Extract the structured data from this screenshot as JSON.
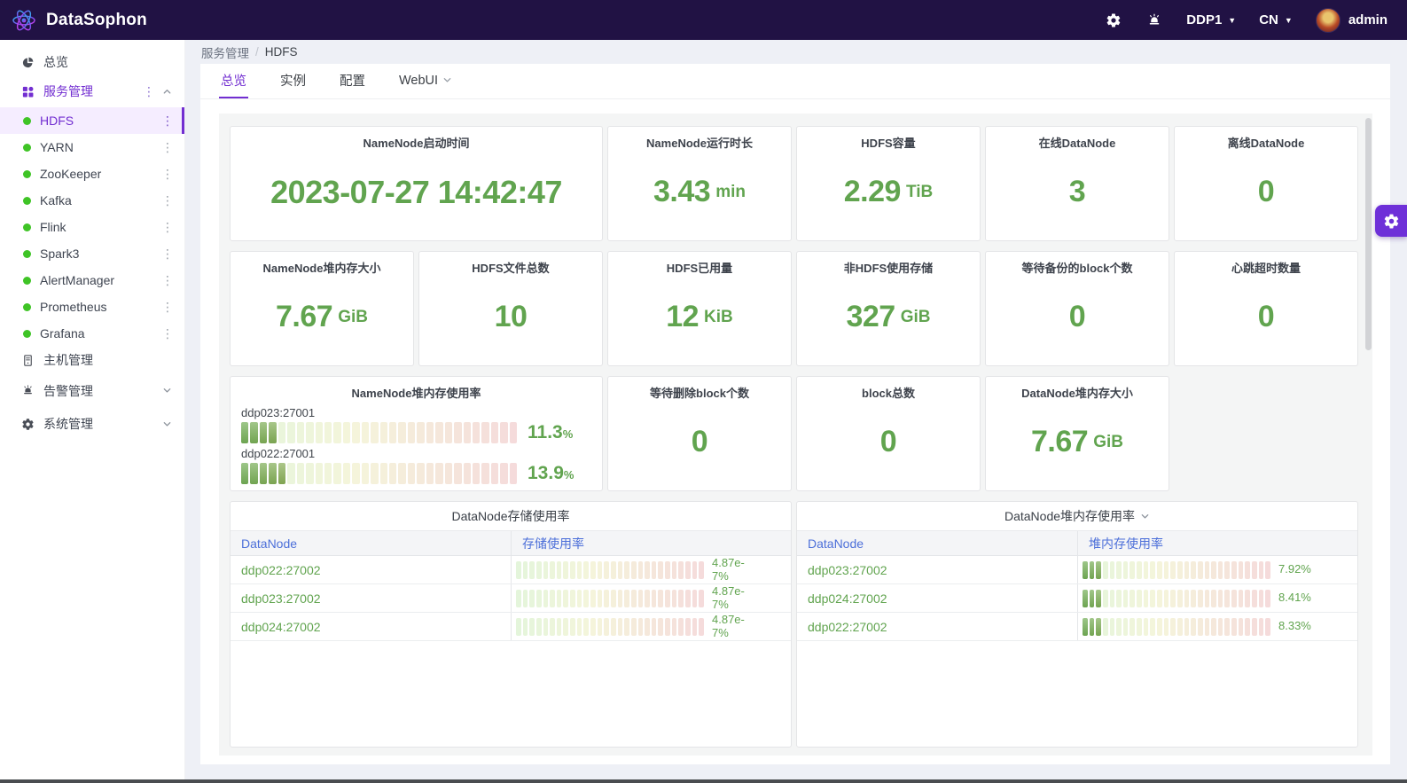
{
  "navbar": {
    "brand": "DataSophon",
    "cluster": "DDP1",
    "lang": "CN",
    "user": "admin"
  },
  "sidebar": {
    "overview": "总览",
    "service_mgmt": "服务管理",
    "services": [
      {
        "name": "HDFS",
        "active": true
      },
      {
        "name": "YARN",
        "active": false
      },
      {
        "name": "ZooKeeper",
        "active": false
      },
      {
        "name": "Kafka",
        "active": false
      },
      {
        "name": "Flink",
        "active": false
      },
      {
        "name": "Spark3",
        "active": false
      },
      {
        "name": "AlertManager",
        "active": false
      },
      {
        "name": "Prometheus",
        "active": false
      },
      {
        "name": "Grafana",
        "active": false
      }
    ],
    "host_mgmt": "主机管理",
    "alert_mgmt": "告警管理",
    "system_mgmt": "系统管理"
  },
  "breadcrumb": [
    "服务管理",
    "HDFS"
  ],
  "tabs": [
    {
      "key": "overview",
      "label": "总览",
      "active": true,
      "dropdown": false
    },
    {
      "key": "instances",
      "label": "实例",
      "active": false,
      "dropdown": false
    },
    {
      "key": "config",
      "label": "配置",
      "active": false,
      "dropdown": false
    },
    {
      "key": "webui",
      "label": "WebUI",
      "active": false,
      "dropdown": true
    }
  ],
  "colors": {
    "accent": "#722ed1",
    "value_green": "#61a44f",
    "link_blue": "#4c6fd9",
    "navbar_bg": "#211244",
    "status_dot_green": "#3fc426"
  },
  "dashboard": {
    "panels": [
      {
        "type": "stat",
        "span": 2,
        "title": "NameNode启动时间",
        "value": "2023-07-27 14:42:47",
        "unit": ""
      },
      {
        "type": "stat",
        "span": 1,
        "title": "NameNode运行时长",
        "value": "3.43",
        "unit": "min"
      },
      {
        "type": "stat",
        "span": 1,
        "title": "HDFS容量",
        "value": "2.29",
        "unit": "TiB"
      },
      {
        "type": "stat",
        "span": 1,
        "title": "在线DataNode",
        "value": "3",
        "unit": ""
      },
      {
        "type": "stat",
        "span": 1,
        "title": "离线DataNode",
        "value": "0",
        "unit": ""
      },
      {
        "type": "stat",
        "span": 1,
        "title": "NameNode堆内存大小",
        "value": "7.67",
        "unit": "GiB"
      },
      {
        "type": "stat",
        "span": 1,
        "title": "HDFS文件总数",
        "value": "10",
        "unit": ""
      },
      {
        "type": "stat",
        "span": 1,
        "title": "HDFS已用量",
        "value": "12",
        "unit": "KiB"
      },
      {
        "type": "stat",
        "span": 1,
        "title": "非HDFS使用存储",
        "value": "327",
        "unit": "GiB"
      },
      {
        "type": "stat",
        "span": 1,
        "title": "等待备份的block个数",
        "value": "0",
        "unit": ""
      },
      {
        "type": "stat",
        "span": 1,
        "title": "心跳超时数量",
        "value": "0",
        "unit": ""
      },
      {
        "type": "gauge",
        "span": 2,
        "title": "NameNode堆内存使用率",
        "segments": 30,
        "gauges": [
          {
            "label": "ddp023:27001",
            "pct": 11.3,
            "display": "11.3"
          },
          {
            "label": "ddp022:27001",
            "pct": 13.9,
            "display": "13.9"
          }
        ]
      },
      {
        "type": "stat",
        "span": 1,
        "title": "等待删除block个数",
        "value": "0",
        "unit": ""
      },
      {
        "type": "stat",
        "span": 1,
        "title": "block总数",
        "value": "0",
        "unit": ""
      },
      {
        "type": "stat",
        "span": 1,
        "title": "DataNode堆内存大小",
        "value": "7.67",
        "unit": "GiB"
      },
      {
        "type": "table",
        "span": 3,
        "title": "DataNode存储使用率",
        "dropdown": false,
        "segments": 28,
        "columns": [
          "DataNode",
          "存储使用率"
        ],
        "rows": [
          {
            "node": "ddp022:27002",
            "pct": 4.87e-07,
            "display": "4.87e-7%"
          },
          {
            "node": "ddp023:27002",
            "pct": 4.87e-07,
            "display": "4.87e-7%"
          },
          {
            "node": "ddp024:27002",
            "pct": 4.87e-07,
            "display": "4.87e-7%"
          }
        ]
      },
      {
        "type": "table",
        "span": 3,
        "title": "DataNode堆内存使用率",
        "dropdown": true,
        "segments": 28,
        "columns": [
          "DataNode",
          "堆内存使用率"
        ],
        "rows": [
          {
            "node": "ddp023:27002",
            "pct": 7.92,
            "display": "7.92%"
          },
          {
            "node": "ddp024:27002",
            "pct": 8.41,
            "display": "8.41%"
          },
          {
            "node": "ddp022:27002",
            "pct": 8.33,
            "display": "8.33%"
          }
        ]
      }
    ]
  }
}
